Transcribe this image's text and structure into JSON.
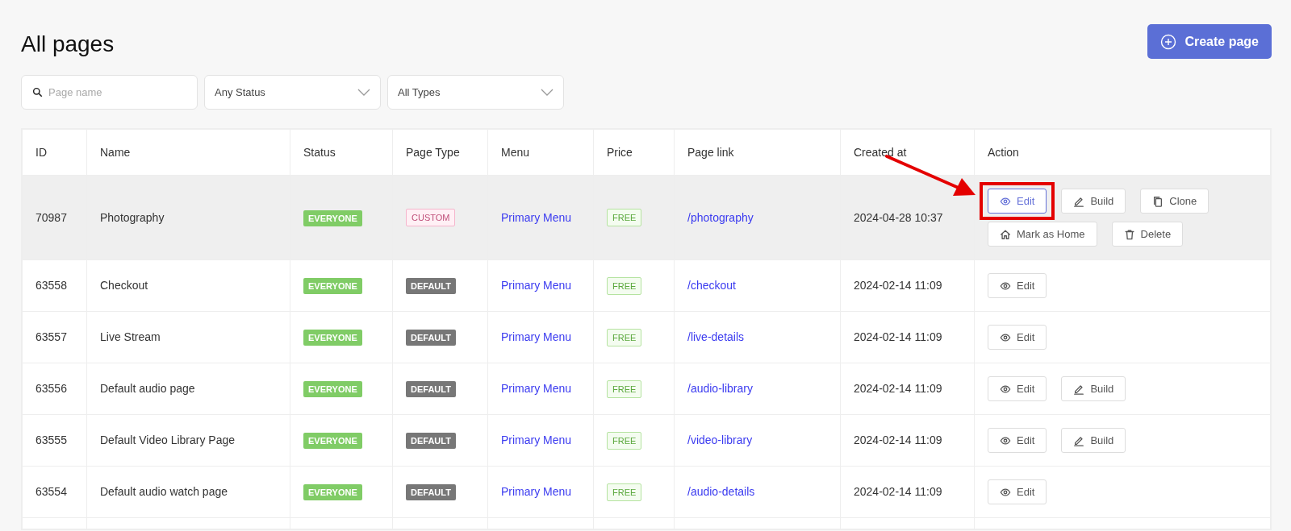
{
  "title": "All pages",
  "create_button": {
    "label": "Create page"
  },
  "filters": {
    "search": {
      "placeholder": "Page name"
    },
    "status": {
      "value": "Any Status"
    },
    "type": {
      "value": "All Types"
    }
  },
  "table": {
    "columns": [
      "ID",
      "Name",
      "Status",
      "Page Type",
      "Menu",
      "Price",
      "Page link",
      "Created at",
      "Action"
    ],
    "rows": [
      {
        "id": "70987",
        "name": "Photography",
        "status": "EVERYONE",
        "page_type": "CUSTOM",
        "kind": "custom",
        "menu": "Primary Menu",
        "price": "FREE",
        "link": "/photography",
        "created": "2024-04-28 10:37",
        "highlighted": true,
        "actions": [
          {
            "kind": "edit",
            "label": "Edit",
            "highlighted": true
          },
          {
            "kind": "build",
            "label": "Build",
            "highlighted": false
          },
          {
            "kind": "clone",
            "label": "Clone",
            "highlighted": false
          },
          {
            "kind": "home",
            "label": "Mark as Home",
            "highlighted": false
          },
          {
            "kind": "delete",
            "label": "Delete",
            "highlighted": false
          }
        ]
      },
      {
        "id": "63558",
        "name": "Checkout",
        "status": "EVERYONE",
        "page_type": "DEFAULT",
        "kind": "default",
        "menu": "Primary Menu",
        "price": "FREE",
        "link": "/checkout",
        "created": "2024-02-14 11:09",
        "highlighted": false,
        "actions": [
          {
            "kind": "edit",
            "label": "Edit",
            "highlighted": false
          }
        ]
      },
      {
        "id": "63557",
        "name": "Live Stream",
        "status": "EVERYONE",
        "page_type": "DEFAULT",
        "kind": "default",
        "menu": "Primary Menu",
        "price": "FREE",
        "link": "/live-details",
        "created": "2024-02-14 11:09",
        "highlighted": false,
        "actions": [
          {
            "kind": "edit",
            "label": "Edit",
            "highlighted": false
          }
        ]
      },
      {
        "id": "63556",
        "name": "Default audio page",
        "status": "EVERYONE",
        "page_type": "DEFAULT",
        "kind": "default",
        "menu": "Primary Menu",
        "price": "FREE",
        "link": "/audio-library",
        "created": "2024-02-14 11:09",
        "highlighted": false,
        "actions": [
          {
            "kind": "edit",
            "label": "Edit",
            "highlighted": false
          },
          {
            "kind": "build",
            "label": "Build",
            "highlighted": false
          }
        ]
      },
      {
        "id": "63555",
        "name": "Default Video Library Page",
        "status": "EVERYONE",
        "page_type": "DEFAULT",
        "kind": "default",
        "menu": "Primary Menu",
        "price": "FREE",
        "link": "/video-library",
        "created": "2024-02-14 11:09",
        "highlighted": false,
        "actions": [
          {
            "kind": "edit",
            "label": "Edit",
            "highlighted": false
          },
          {
            "kind": "build",
            "label": "Build",
            "highlighted": false
          }
        ]
      },
      {
        "id": "63554",
        "name": "Default audio watch page",
        "status": "EVERYONE",
        "page_type": "DEFAULT",
        "kind": "default",
        "menu": "Primary Menu",
        "price": "FREE",
        "link": "/audio-details",
        "created": "2024-02-14 11:09",
        "highlighted": false,
        "actions": [
          {
            "kind": "edit",
            "label": "Edit",
            "highlighted": false
          }
        ]
      }
    ]
  }
}
